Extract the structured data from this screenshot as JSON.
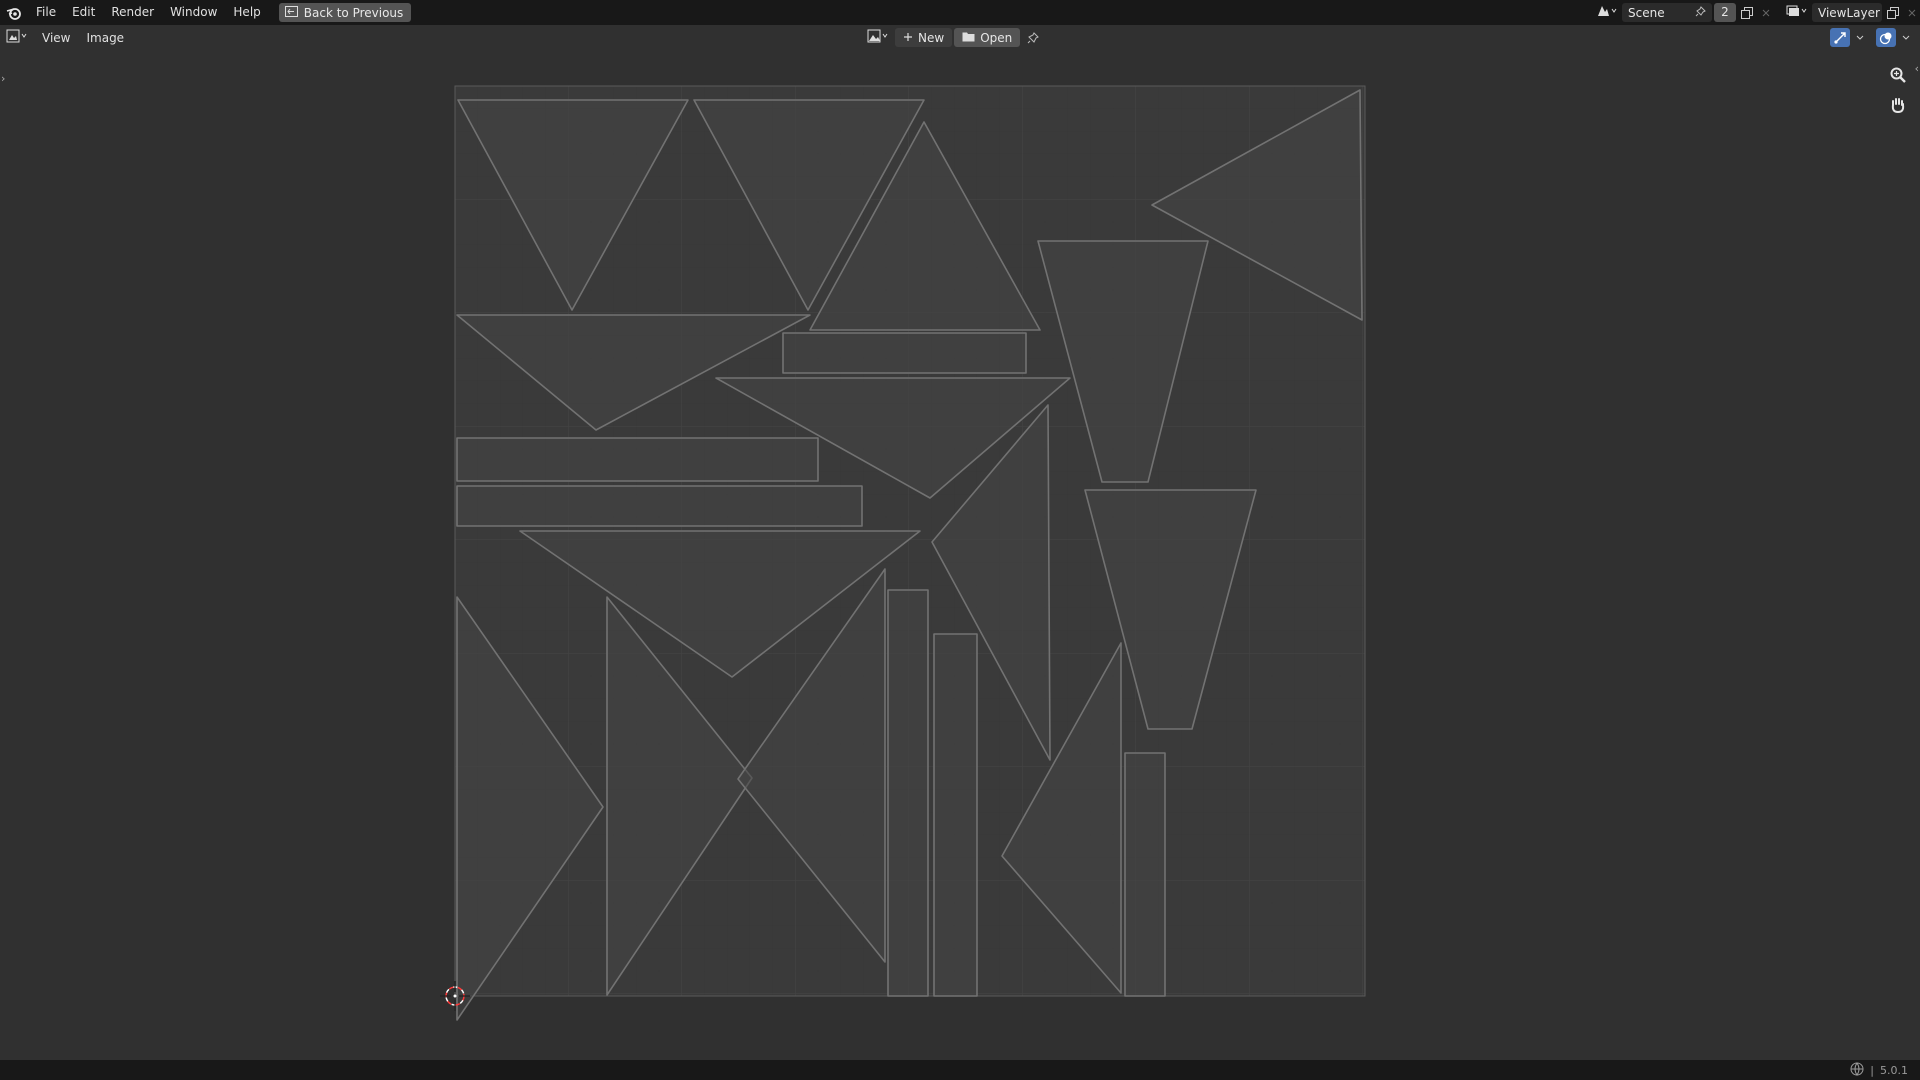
{
  "topbar": {
    "menus": [
      "File",
      "Edit",
      "Render",
      "Window",
      "Help"
    ],
    "back_button": "Back to Previous",
    "scene_name": "Scene",
    "scene_users": "2",
    "view_layer": "ViewLayer"
  },
  "editor_header": {
    "menus": [
      "View",
      "Image"
    ],
    "new_label": "New",
    "open_label": "Open"
  },
  "statusbar": {
    "version": "5.0.1"
  },
  "colors": {
    "background": "#303030",
    "topbar": "#181818",
    "uv_fill": "#454545",
    "uv_edge": "#6e6e6e",
    "button": "#545454",
    "accent": "#4772b3"
  },
  "icons": [
    "blender-logo-icon",
    "back-icon",
    "scene-icon",
    "pin-icon",
    "copy-icon",
    "close-icon",
    "view-layer-icon",
    "image-editor-icon",
    "image-icon",
    "plus-icon",
    "folder-icon",
    "gizmo-icon",
    "overlay-icon",
    "zoom-icon",
    "hand-icon",
    "cursor-icon",
    "network-icon"
  ]
}
